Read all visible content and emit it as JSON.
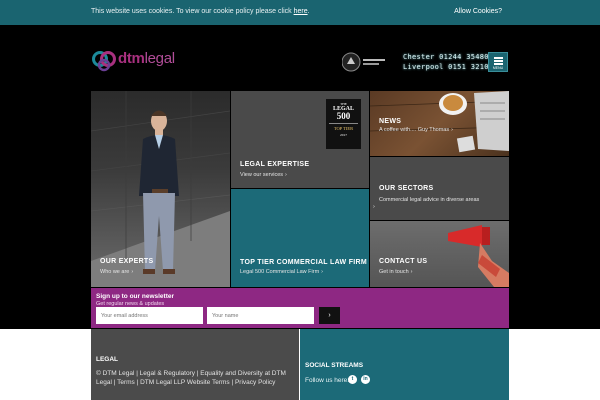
{
  "cookie": {
    "message": "This website uses cookies. To view our cookie policy please click ",
    "link": "here",
    "period": ".",
    "allow": "Allow Cookies?"
  },
  "header": {
    "logo_prefix": "dtm",
    "logo_suffix": "legal",
    "phone_chester": "Chester 01244 354800",
    "phone_liverpool": "Liverpool 0151 3210000",
    "menu_label": "MENU"
  },
  "tiles": {
    "experts": {
      "title": "OUR EXPERTS",
      "sub": "Who we are",
      "chev": "›"
    },
    "legal": {
      "title": "LEGAL EXPERTISE",
      "sub": "View our services",
      "chev": "›"
    },
    "legal500": {
      "line1": "THE",
      "line2": "LEGAL",
      "line3": "500",
      "line4": "TOP TIER",
      "line5": "2017"
    },
    "news": {
      "title": "NEWS",
      "sub": "A coffee with.... Guy Thomas",
      "chev": "›"
    },
    "sectors": {
      "title": "OUR SECTORS",
      "sub": "Commercial legal advice in diverse areas",
      "chev": "›"
    },
    "toptier": {
      "title": "TOP TIER COMMERCIAL LAW FIRM",
      "sub": "Legal 500 Commercial Law Firm",
      "chev": "›"
    },
    "contact": {
      "title": "CONTACT US",
      "sub": "Get in touch",
      "chev": "›"
    }
  },
  "newsletter": {
    "title": "Sign up to our newsletter",
    "subtitle": "Get regular news & updates",
    "email_placeholder": "Your email address",
    "name_placeholder": "Your name",
    "submit": "›"
  },
  "footer": {
    "legal_title": "LEGAL",
    "legal_links": "© DTM Legal | Legal & Regulatory | Equality and Diversity at DTM Legal | Terms | DTM Legal LLP Website Terms | Privacy Policy",
    "social_title": "SOCIAL STREAMS",
    "follow": "Follow us here:",
    "twitter": "t",
    "linkedin": "in"
  },
  "colors": {
    "teal": "#1c6a78",
    "purple": "#8e2883",
    "brand_magenta": "#a8307f"
  }
}
